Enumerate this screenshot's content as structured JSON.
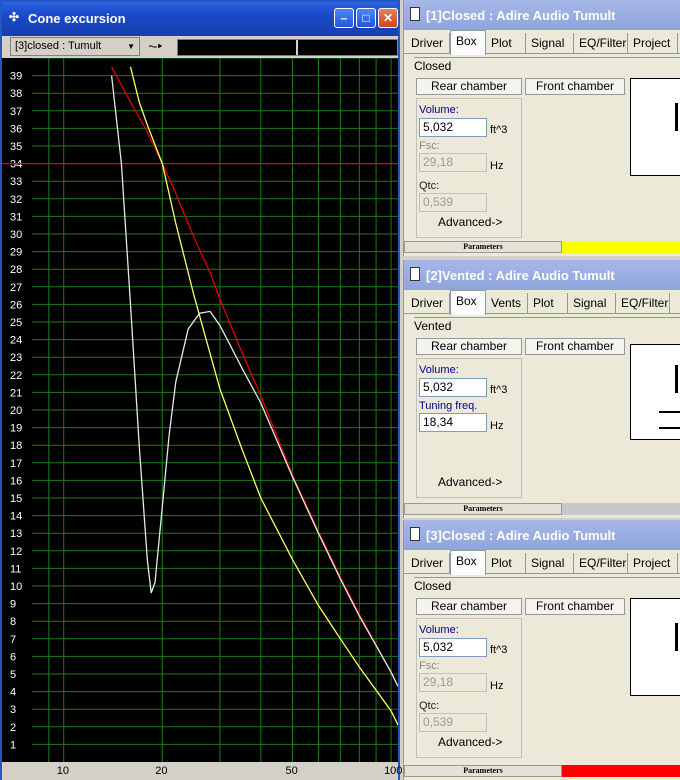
{
  "left_window": {
    "title": "Cone excursion",
    "combo_value": "[3]closed : Tumult",
    "x_ticks": [
      "10",
      "20",
      "50",
      "100"
    ],
    "y_ticks": [
      "1",
      "2",
      "3",
      "4",
      "5",
      "6",
      "7",
      "8",
      "9",
      "10",
      "11",
      "12",
      "13",
      "14",
      "15",
      "16",
      "17",
      "18",
      "19",
      "20",
      "21",
      "22",
      "23",
      "24",
      "25",
      "26",
      "27",
      "28",
      "29",
      "30",
      "31",
      "32",
      "33",
      "34",
      "35",
      "36",
      "37",
      "38",
      "39"
    ]
  },
  "panels": [
    {
      "title": "[1]Closed : Adire Audio Tumult",
      "tabs": [
        "Driver",
        "Box",
        "Plot",
        "Signal",
        "EQ/Filter",
        "Project"
      ],
      "active_tab": "Box",
      "box_type": "Closed",
      "rear_label": "Rear chamber",
      "front_label": "Front chamber",
      "volume_label": "Volume:",
      "volume_value": "5,032",
      "volume_unit": "ft^3",
      "freq_label": "Fsc:",
      "freq_value": "29,18",
      "freq_unit": "Hz",
      "qtc_label": "Qtc:",
      "qtc_value": "0,539",
      "advanced": "Advanced->",
      "parameters": "Parameters",
      "bar_color": "#ffff00"
    },
    {
      "title": "[2]Vented : Adire Audio Tumult",
      "tabs": [
        "Driver",
        "Box",
        "Vents",
        "Plot",
        "Signal",
        "EQ/Filter"
      ],
      "active_tab": "Box",
      "box_type": "Vented",
      "rear_label": "Rear chamber",
      "front_label": "Front chamber",
      "volume_label": "Volume:",
      "volume_value": "5,032",
      "volume_unit": "ft^3",
      "freq_label": "Tuning freq.",
      "freq_value": "18,34",
      "freq_unit": "Hz",
      "advanced": "Advanced->",
      "parameters": "Parameters",
      "bar_color": "#c8c8c8"
    },
    {
      "title": "[3]Closed : Adire Audio Tumult",
      "tabs": [
        "Driver",
        "Box",
        "Plot",
        "Signal",
        "EQ/Filter",
        "Project"
      ],
      "active_tab": "Box",
      "box_type": "Closed",
      "rear_label": "Rear chamber",
      "front_label": "Front chamber",
      "volume_label": "Volume:",
      "volume_value": "5,032",
      "volume_unit": "ft^3",
      "freq_label": "Fsc:",
      "freq_value": "29,18",
      "freq_unit": "Hz",
      "qtc_label": "Qtc:",
      "qtc_value": "0,539",
      "advanced": "Advanced->",
      "parameters": "Parameters",
      "bar_color": "#ff0000"
    }
  ],
  "chart_data": {
    "type": "line",
    "x_scale": "log",
    "xlim": [
      8,
      105
    ],
    "ylim": [
      0,
      40
    ],
    "x_ticks": [
      10,
      20,
      50,
      100
    ],
    "grid": true,
    "reference_line_y": 34,
    "series": [
      {
        "color": "#e00000",
        "x": [
          14,
          16,
          18,
          20,
          22,
          25,
          28,
          30,
          35,
          40,
          50,
          60,
          70,
          80,
          100,
          105
        ],
        "y": [
          39.5,
          37.5,
          35.8,
          34,
          32.3,
          29.8,
          27.8,
          26.3,
          23.3,
          20.8,
          16.3,
          13.1,
          10.5,
          8.4,
          5.1,
          4.3
        ]
      },
      {
        "color": "#ffff60",
        "x": [
          16,
          17,
          18,
          20,
          22,
          25,
          28,
          30,
          35,
          40,
          50,
          60,
          70,
          80,
          100,
          105
        ],
        "y": [
          39.5,
          37.5,
          36.2,
          34,
          30.6,
          26.5,
          23.2,
          21.2,
          17.8,
          15.0,
          11.5,
          8.9,
          7.0,
          5.4,
          2.9,
          2.1
        ]
      },
      {
        "color": "#e8e8e8",
        "x": [
          14,
          15,
          16,
          17,
          18,
          18.5,
          19,
          20,
          21,
          22,
          24,
          26,
          28,
          30,
          32,
          35,
          40,
          50,
          60,
          70,
          80,
          100,
          105
        ],
        "y": [
          39,
          34,
          26,
          18,
          11.5,
          9.6,
          10.2,
          14.5,
          18.6,
          21.6,
          24.6,
          25.5,
          25.6,
          24.8,
          23.8,
          22.4,
          20.4,
          16.2,
          13.0,
          10.4,
          8.3,
          5.1,
          4.3
        ]
      }
    ]
  }
}
